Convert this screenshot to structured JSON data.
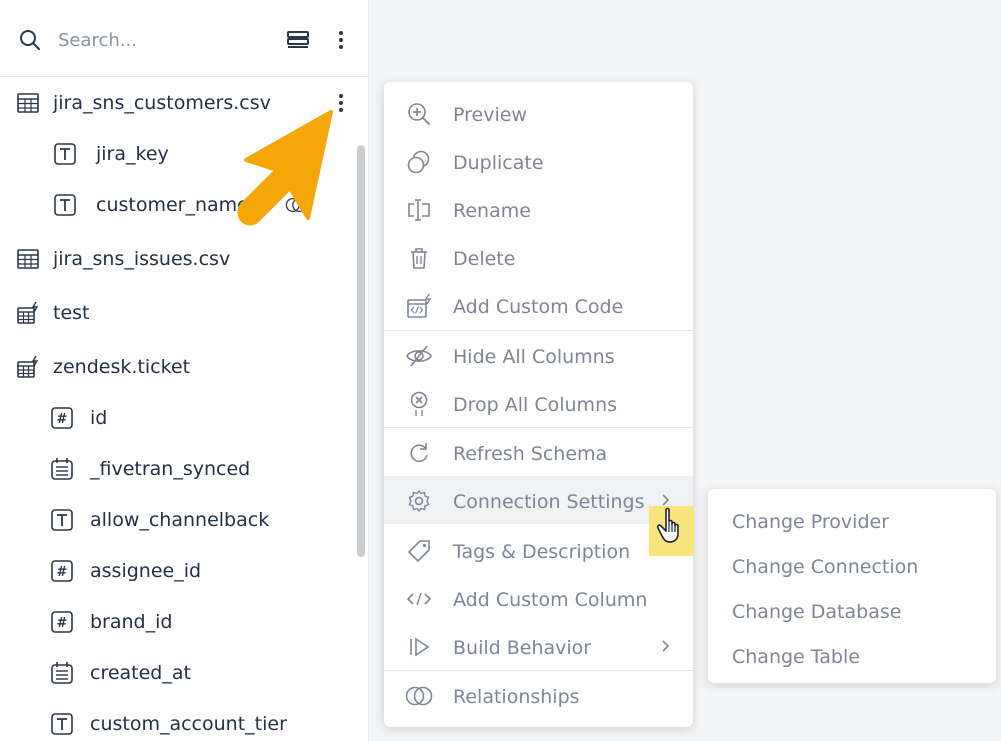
{
  "search": {
    "placeholder": "Search..."
  },
  "tree": [
    {
      "label": "jira_sns_customers.csv",
      "icon": "table-icon"
    },
    {
      "label": "jira_key",
      "icon": "text-type-icon"
    },
    {
      "label": "customer_name",
      "icon": "text-type-icon"
    },
    {
      "label": "jira_sns_issues.csv",
      "icon": "table-icon"
    },
    {
      "label": "test",
      "icon": "custom-table-icon"
    },
    {
      "label": "zendesk.ticket",
      "icon": "custom-table-icon"
    },
    {
      "label": "id",
      "icon": "number-type-icon"
    },
    {
      "label": "_fivetran_synced",
      "icon": "datetime-type-icon"
    },
    {
      "label": "allow_channelback",
      "icon": "text-type-icon"
    },
    {
      "label": "assignee_id",
      "icon": "number-type-icon"
    },
    {
      "label": "brand_id",
      "icon": "number-type-icon"
    },
    {
      "label": "created_at",
      "icon": "datetime-type-icon"
    },
    {
      "label": "custom_account_tier",
      "icon": "text-type-icon"
    }
  ],
  "menu": [
    {
      "label": "Preview",
      "icon": "zoom-in-icon"
    },
    {
      "label": "Duplicate",
      "icon": "duplicate-icon"
    },
    {
      "label": "Rename",
      "icon": "rename-icon"
    },
    {
      "label": "Delete",
      "icon": "trash-icon"
    },
    {
      "label": "Add Custom Code",
      "icon": "custom-code-icon"
    },
    {
      "label": "Hide All Columns",
      "icon": "eye-off-icon"
    },
    {
      "label": "Drop All Columns",
      "icon": "drop-icon"
    },
    {
      "label": "Refresh Schema",
      "icon": "refresh-icon"
    },
    {
      "label": "Connection Settings",
      "icon": "gear-icon"
    },
    {
      "label": "Tags & Description",
      "icon": "tag-icon"
    },
    {
      "label": "Add Custom Column",
      "icon": "code-brackets-icon"
    },
    {
      "label": "Build Behavior",
      "icon": "play-step-icon"
    },
    {
      "label": "Relationships",
      "icon": "relationships-icon"
    }
  ],
  "submenu": [
    {
      "label": "Change Provider"
    },
    {
      "label": "Change Connection"
    },
    {
      "label": "Change Database"
    },
    {
      "label": "Change Table"
    }
  ],
  "colors": {
    "menu_text": "#7d8696",
    "tree_text": "#22304a",
    "arrow": "#f5a70a",
    "highlight": "#f9e166"
  }
}
